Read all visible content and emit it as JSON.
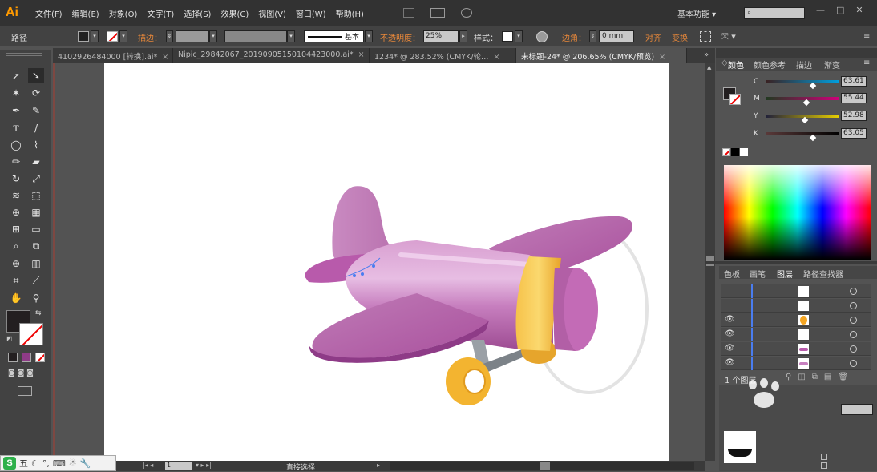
{
  "app": {
    "logo": "Ai"
  },
  "menu": [
    "文件(F)",
    "编辑(E)",
    "对象(O)",
    "文字(T)",
    "选择(S)",
    "效果(C)",
    "视图(V)",
    "窗口(W)",
    "帮助(H)"
  ],
  "workspace": "基本功能",
  "control_bar": {
    "selection_label": "路径",
    "stroke_label": "描边：",
    "brush_value": "基本",
    "opacity_label": "不透明度：",
    "opacity_value": "25%",
    "style_label": "样式：",
    "corner_label": "边角：",
    "corner_value": "0 mm",
    "align_label": "对齐",
    "transform_label": "变换"
  },
  "tabs": [
    {
      "label": "4102926484000 [转换].ai*",
      "active": false
    },
    {
      "label": "Nipic_29842067_20190905150104423000.ai*",
      "active": false
    },
    {
      "label": "1234* @ 283.52% (CMYK/轮…",
      "active": false
    },
    {
      "label": "未标题-24* @ 206.65% (CMYK/预览)",
      "active": true
    }
  ],
  "color_panel": {
    "tabs": [
      "颜色",
      "颜色参考",
      "描边",
      "渐变"
    ],
    "channels": [
      {
        "label": "C",
        "value": "63.61",
        "color_from": "#00a0e0"
      },
      {
        "label": "M",
        "value": "55.44",
        "color_from": "#d0007a"
      },
      {
        "label": "Y",
        "value": "52.98",
        "color_from": "#e8d000"
      },
      {
        "label": "K",
        "value": "63.05",
        "color_from": "#000000"
      }
    ]
  },
  "layers_panel": {
    "tabs": [
      "色板",
      "画笔",
      "图层",
      "路径查找器"
    ],
    "footer": "1 个图层"
  },
  "bottom": {
    "page": "1",
    "status": "直接选择"
  },
  "ime": {
    "label": "五"
  },
  "airplane_colors": {
    "body": "#c77fbf",
    "wing": "#b85aab",
    "ring": "#f5b43a",
    "wheel": "#f3b430",
    "strut": "#9aa0a6"
  }
}
